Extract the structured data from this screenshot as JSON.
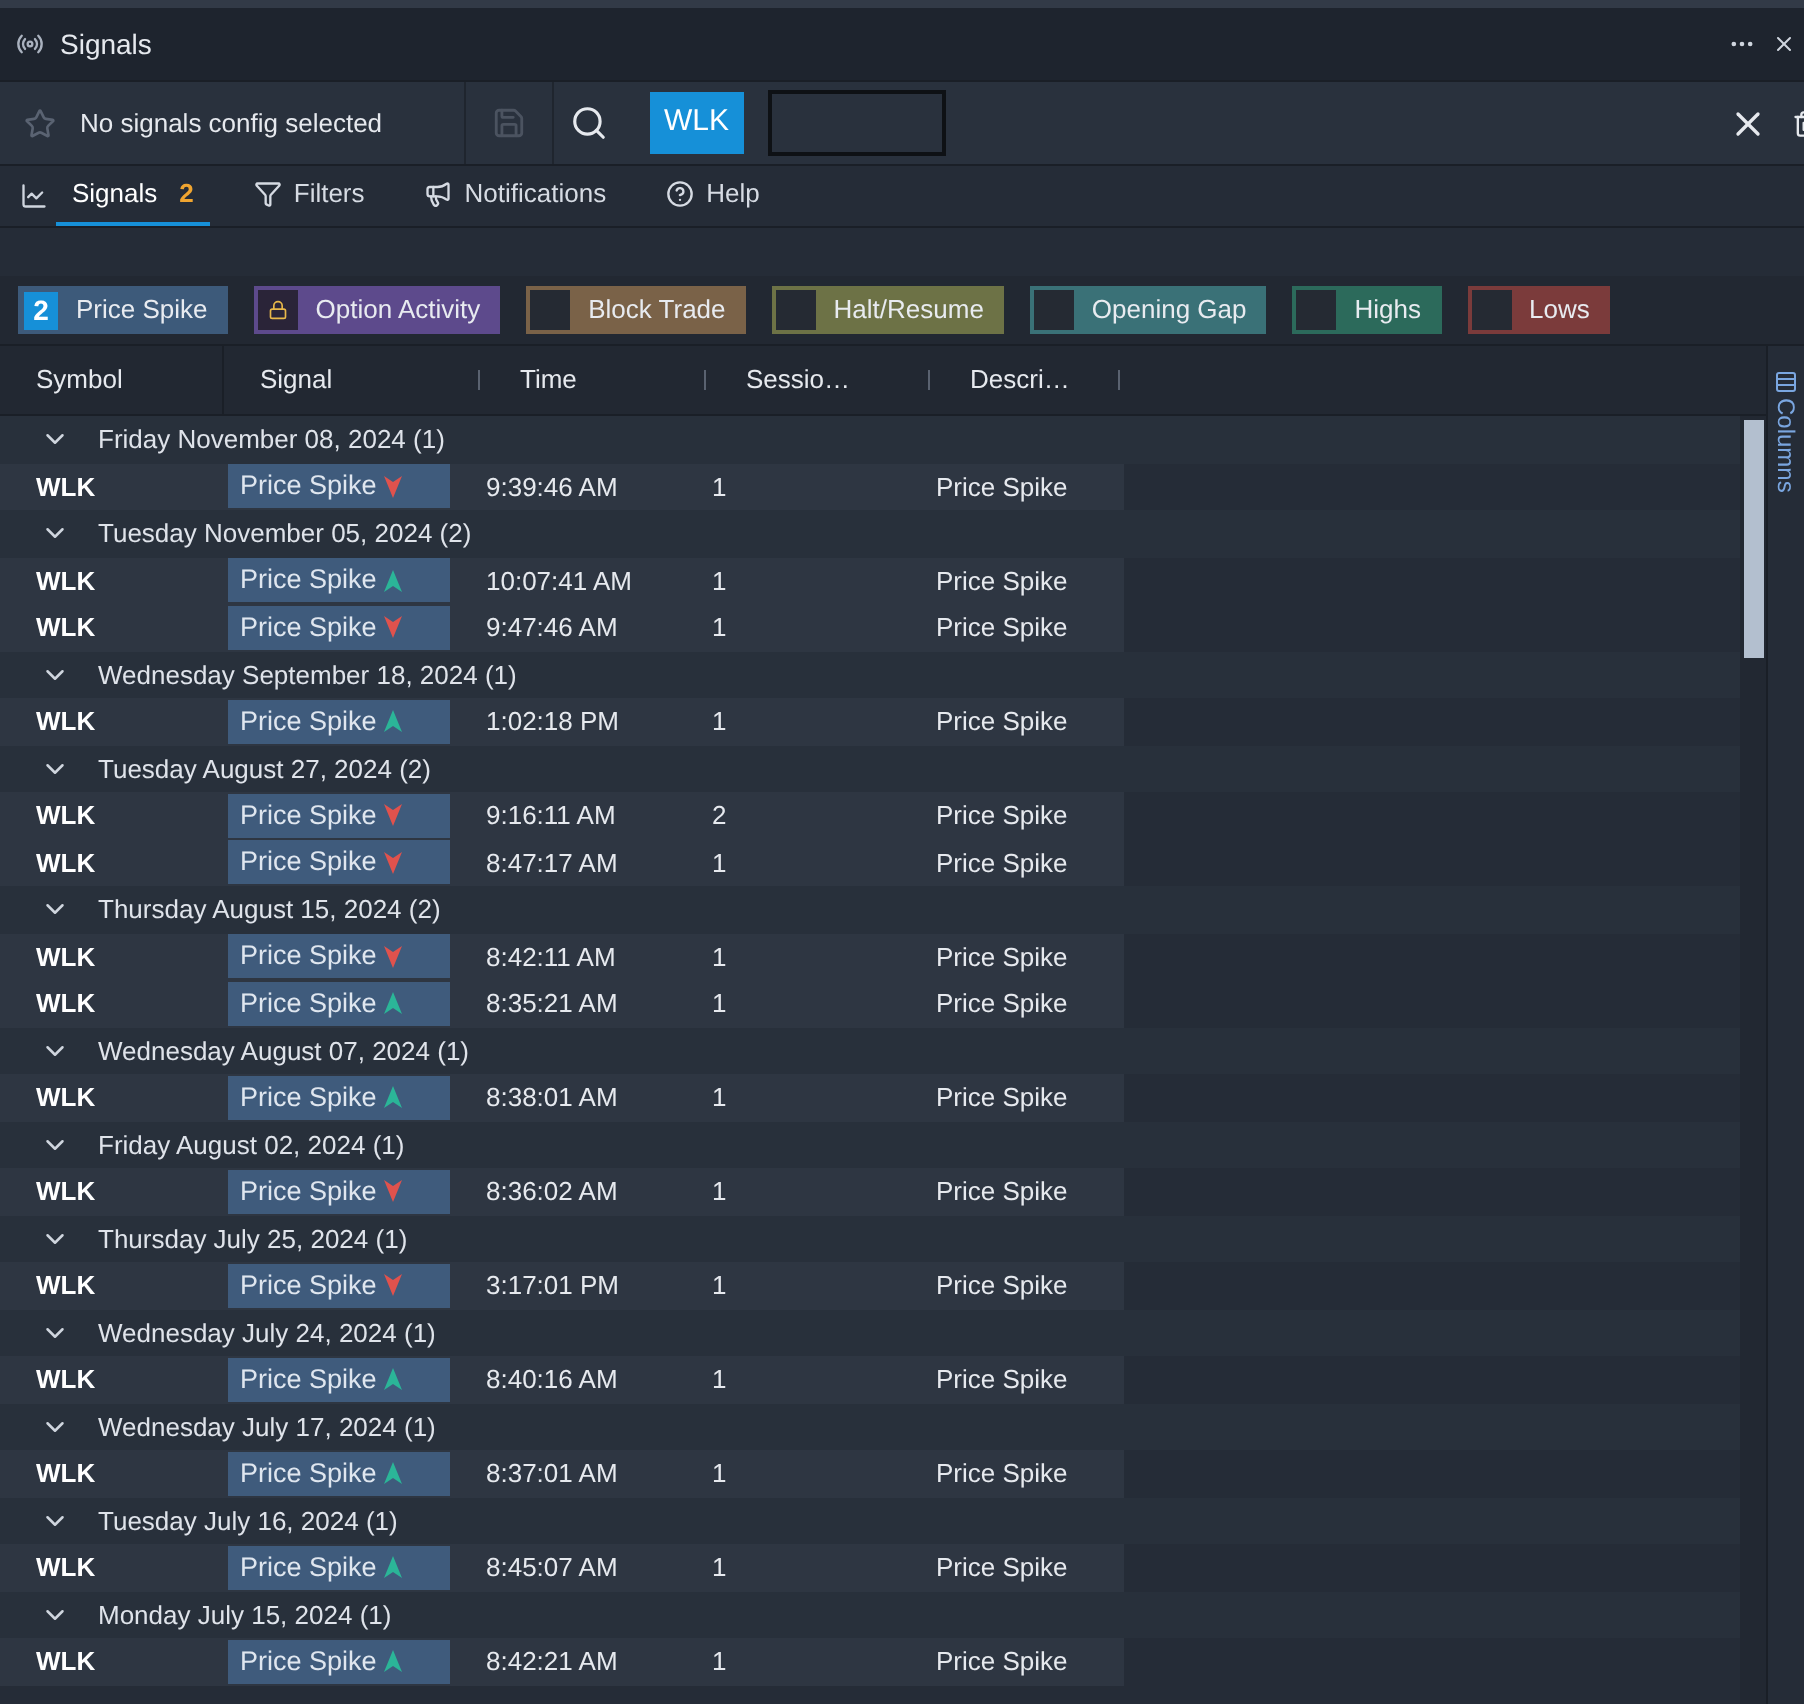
{
  "window": {
    "title": "Signals"
  },
  "toolbar": {
    "config_label": "No signals config selected",
    "symbol_tag": "WLK"
  },
  "tabs": [
    {
      "label": "Signals",
      "badge": "2",
      "selected": true
    },
    {
      "label": "Filters",
      "selected": false
    },
    {
      "label": "Notifications",
      "selected": false
    },
    {
      "label": "Help",
      "selected": false
    }
  ],
  "signal_types": [
    {
      "label": "Price Spike",
      "kind": "count",
      "count": "2",
      "color": "#3d5a7a"
    },
    {
      "label": "Option Activity",
      "kind": "locked",
      "color": "#5d4a8c"
    },
    {
      "label": "Block Trade",
      "kind": "checkbox",
      "checked": false,
      "color": "#7a6248"
    },
    {
      "label": "Halt/Resume",
      "kind": "checkbox",
      "checked": false,
      "color": "#6d7246"
    },
    {
      "label": "Opening Gap",
      "kind": "checkbox",
      "checked": false,
      "color": "#3a7177"
    },
    {
      "label": "Highs",
      "kind": "checkbox",
      "checked": false,
      "color": "#2c6a5b"
    },
    {
      "label": "Lows",
      "kind": "checkbox",
      "checked": false,
      "color": "#7b3b3b"
    }
  ],
  "table": {
    "columns": [
      "Symbol",
      "Signal",
      "Time",
      "Sessio…",
      "Descri…"
    ],
    "groups": [
      {
        "date": "Friday November 08, 2024",
        "count": "(1)",
        "expanded": true,
        "rows": [
          {
            "symbol": "WLK",
            "signal": "Price Spike",
            "kind": "down",
            "time": "9:39:46 AM",
            "session": "1",
            "description": "Price Spike"
          }
        ]
      },
      {
        "date": "Tuesday November 05, 2024",
        "count": "(2)",
        "expanded": true,
        "rows": [
          {
            "symbol": "WLK",
            "signal": "Price Spike",
            "kind": "up",
            "time": "10:07:41 AM",
            "session": "1",
            "description": "Price Spike"
          },
          {
            "symbol": "WLK",
            "signal": "Price Spike",
            "kind": "down",
            "time": "9:47:46 AM",
            "session": "1",
            "description": "Price Spike"
          }
        ]
      },
      {
        "date": "Wednesday September 18, 2024",
        "count": "(1)",
        "expanded": true,
        "rows": [
          {
            "symbol": "WLK",
            "signal": "Price Spike",
            "kind": "up",
            "time": "1:02:18 PM",
            "session": "1",
            "description": "Price Spike"
          }
        ]
      },
      {
        "date": "Tuesday August 27, 2024",
        "count": "(2)",
        "expanded": true,
        "rows": [
          {
            "symbol": "WLK",
            "signal": "Price Spike",
            "kind": "down",
            "time": "9:16:11 AM",
            "session": "2",
            "description": "Price Spike"
          },
          {
            "symbol": "WLK",
            "signal": "Price Spike",
            "kind": "down",
            "time": "8:47:17 AM",
            "session": "1",
            "description": "Price Spike"
          }
        ]
      },
      {
        "date": "Thursday August 15, 2024",
        "count": "(2)",
        "expanded": true,
        "rows": [
          {
            "symbol": "WLK",
            "signal": "Price Spike",
            "kind": "down",
            "time": "8:42:11 AM",
            "session": "1",
            "description": "Price Spike"
          },
          {
            "symbol": "WLK",
            "signal": "Price Spike",
            "kind": "up",
            "time": "8:35:21 AM",
            "session": "1",
            "description": "Price Spike"
          }
        ]
      },
      {
        "date": "Wednesday August 07, 2024",
        "count": "(1)",
        "expanded": true,
        "rows": [
          {
            "symbol": "WLK",
            "signal": "Price Spike",
            "kind": "up",
            "time": "8:38:01 AM",
            "session": "1",
            "description": "Price Spike"
          }
        ]
      },
      {
        "date": "Friday August 02, 2024",
        "count": "(1)",
        "expanded": true,
        "rows": [
          {
            "symbol": "WLK",
            "signal": "Price Spike",
            "kind": "down",
            "time": "8:36:02 AM",
            "session": "1",
            "description": "Price Spike"
          }
        ]
      },
      {
        "date": "Thursday July 25, 2024",
        "count": "(1)",
        "expanded": true,
        "rows": [
          {
            "symbol": "WLK",
            "signal": "Price Spike",
            "kind": "down",
            "time": "3:17:01 PM",
            "session": "1",
            "description": "Price Spike"
          }
        ]
      },
      {
        "date": "Wednesday July 24, 2024",
        "count": "(1)",
        "expanded": true,
        "rows": [
          {
            "symbol": "WLK",
            "signal": "Price Spike",
            "kind": "up",
            "time": "8:40:16 AM",
            "session": "1",
            "description": "Price Spike"
          }
        ]
      },
      {
        "date": "Wednesday July 17, 2024",
        "count": "(1)",
        "expanded": true,
        "rows": [
          {
            "symbol": "WLK",
            "signal": "Price Spike",
            "kind": "up",
            "time": "8:37:01 AM",
            "session": "1",
            "description": "Price Spike"
          }
        ]
      },
      {
        "date": "Tuesday July 16, 2024",
        "count": "(1)",
        "expanded": true,
        "rows": [
          {
            "symbol": "WLK",
            "signal": "Price Spike",
            "kind": "up",
            "time": "8:45:07 AM",
            "session": "1",
            "description": "Price Spike"
          }
        ]
      },
      {
        "date": "Monday July 15, 2024",
        "count": "(1)",
        "expanded": true,
        "rows": [
          {
            "symbol": "WLK",
            "signal": "Price Spike",
            "kind": "up",
            "time": "8:42:21 AM",
            "session": "1",
            "description": "Price Spike"
          }
        ]
      }
    ]
  },
  "side_panel": {
    "label": "Columns"
  }
}
